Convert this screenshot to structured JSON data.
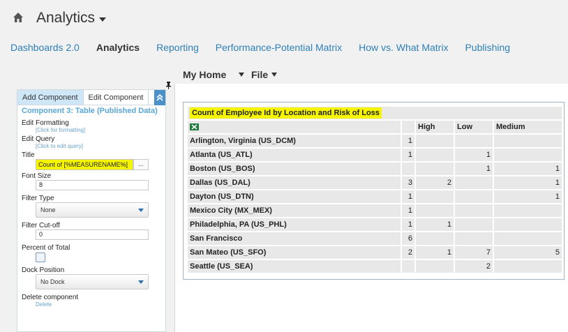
{
  "header": {
    "app_title": "Analytics",
    "nav_tabs": [
      {
        "label": "Dashboards 2.0",
        "active": false
      },
      {
        "label": "Analytics",
        "active": true
      },
      {
        "label": "Reporting",
        "active": false
      },
      {
        "label": "Performance-Potential Matrix",
        "active": false
      },
      {
        "label": "How vs. What Matrix",
        "active": false
      },
      {
        "label": "Publishing",
        "active": false
      }
    ]
  },
  "toolbar": {
    "my_home": "My Home",
    "file": "File"
  },
  "panel": {
    "tab_add": "Add Component",
    "tab_edit": "Edit Component",
    "component_title": "Component 3: Table (Published Data)",
    "edit_formatting_label": "Edit Formatting",
    "edit_formatting_link": "[Click for formatting]",
    "edit_query_label": "Edit Query",
    "edit_query_link": "[Click to edit query]",
    "title_label": "Title",
    "title_value": "Count of [%MEASURENAME%]",
    "title_button": "...",
    "font_size_label": "Font Size",
    "font_size_value": "8",
    "filter_type_label": "Filter Type",
    "filter_type_value": "None",
    "filter_cutoff_label": "Filter Cut-off",
    "filter_cutoff_value": "0",
    "percent_total_label": "Percent of Total",
    "dock_position_label": "Dock Position",
    "dock_position_value": "No Dock",
    "delete_label": "Delete component",
    "delete_link": "Delete"
  },
  "report": {
    "title": "Count of Employee Id by Location and Risk of Loss",
    "columns": [
      "",
      "High",
      "Low",
      "Medium"
    ],
    "rows": [
      {
        "location": "Arlington, Virginia (US_DCM)",
        "values": [
          "1",
          "",
          "",
          ""
        ]
      },
      {
        "location": "Atlanta (US_ATL)",
        "values": [
          "1",
          "",
          "1",
          ""
        ]
      },
      {
        "location": "Boston (US_BOS)",
        "values": [
          "",
          "",
          "1",
          "1"
        ]
      },
      {
        "location": "Dallas (US_DAL)",
        "values": [
          "3",
          "2",
          "",
          "1"
        ]
      },
      {
        "location": "Dayton (US_DTN)",
        "values": [
          "1",
          "",
          "",
          "1"
        ]
      },
      {
        "location": "Mexico City (MX_MEX)",
        "values": [
          "1",
          "",
          "",
          ""
        ]
      },
      {
        "location": "Philadelphia, PA (US_PHL)",
        "values": [
          "1",
          "1",
          "",
          ""
        ]
      },
      {
        "location": "San Francisco",
        "values": [
          "6",
          "",
          "",
          ""
        ]
      },
      {
        "location": "San Mateo (US_SFO)",
        "values": [
          "2",
          "1",
          "7",
          "5"
        ]
      },
      {
        "location": "Seattle (US_SEA)",
        "values": [
          "",
          "",
          "2",
          ""
        ]
      }
    ]
  }
}
